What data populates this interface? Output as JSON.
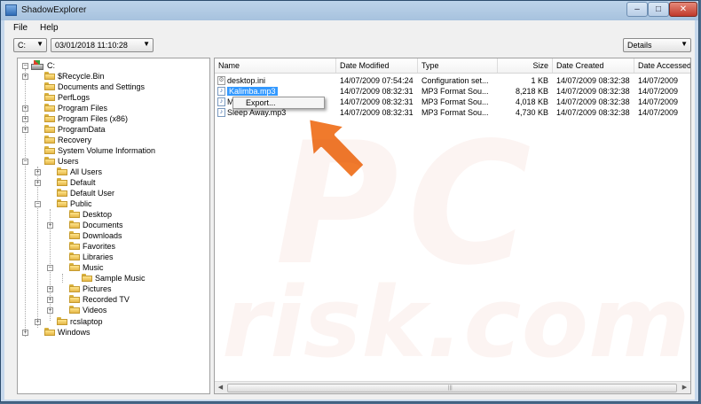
{
  "window": {
    "title": "ShadowExplorer",
    "controls": {
      "minimize": "–",
      "maximize": "□",
      "close": "✕"
    }
  },
  "menu": {
    "file": "File",
    "help": "Help"
  },
  "toolbar": {
    "drive": "C:",
    "snapshot_date": "03/01/2018 11:10:28",
    "view": "Details"
  },
  "tree": {
    "root": "C:",
    "items": {
      "recycle_bin": "$Recycle.Bin",
      "documents_settings": "Documents and Settings",
      "perflogs": "PerfLogs",
      "program_files": "Program Files",
      "program_files_x86": "Program Files (x86)",
      "programdata": "ProgramData",
      "recovery": "Recovery",
      "system_volume_information": "System Volume Information",
      "users": "Users",
      "all_users": "All Users",
      "default": "Default",
      "default_user": "Default User",
      "public": "Public",
      "desktop": "Desktop",
      "documents": "Documents",
      "downloads": "Downloads",
      "favorites": "Favorites",
      "libraries": "Libraries",
      "music": "Music",
      "sample_music": "Sample Music",
      "pictures": "Pictures",
      "recorded_tv": "Recorded TV",
      "videos": "Videos",
      "rcslaptop": "rcslaptop",
      "windows": "Windows"
    }
  },
  "files": {
    "columns": {
      "name": "Name",
      "date_modified": "Date Modified",
      "type": "Type",
      "size": "Size",
      "date_created": "Date Created",
      "date_accessed": "Date Accessed"
    },
    "rows": [
      {
        "name": "desktop.ini",
        "date_modified": "14/07/2009 07:54:24",
        "type": "Configuration set...",
        "size": "1 KB",
        "date_created": "14/07/2009 08:32:38",
        "date_accessed": "14/07/2009"
      },
      {
        "name": "Kalimba.mp3",
        "date_modified": "14/07/2009 08:32:31",
        "type": "MP3 Format Sou...",
        "size": "8,218 KB",
        "date_created": "14/07/2009 08:32:38",
        "date_accessed": "14/07/2009"
      },
      {
        "name": "Maid",
        "date_modified": "14/07/2009 08:32:31",
        "type": "MP3 Format Sou...",
        "size": "4,018 KB",
        "date_created": "14/07/2009 08:32:38",
        "date_accessed": "14/07/2009"
      },
      {
        "name": "Sleep Away.mp3",
        "date_modified": "14/07/2009 08:32:31",
        "type": "MP3 Format Sou...",
        "size": "4,730 KB",
        "date_created": "14/07/2009 08:32:38",
        "date_accessed": "14/07/2009"
      }
    ]
  },
  "context_menu": {
    "export": "Export..."
  },
  "annotation": {
    "arrow_color": "#f07a2c"
  },
  "watermark": {
    "top": "PC",
    "bottom": "risk.com"
  },
  "colors": {
    "selection": "#3399ff",
    "titlebar": "#bcd3ea",
    "folder": "#f4cf5c"
  }
}
